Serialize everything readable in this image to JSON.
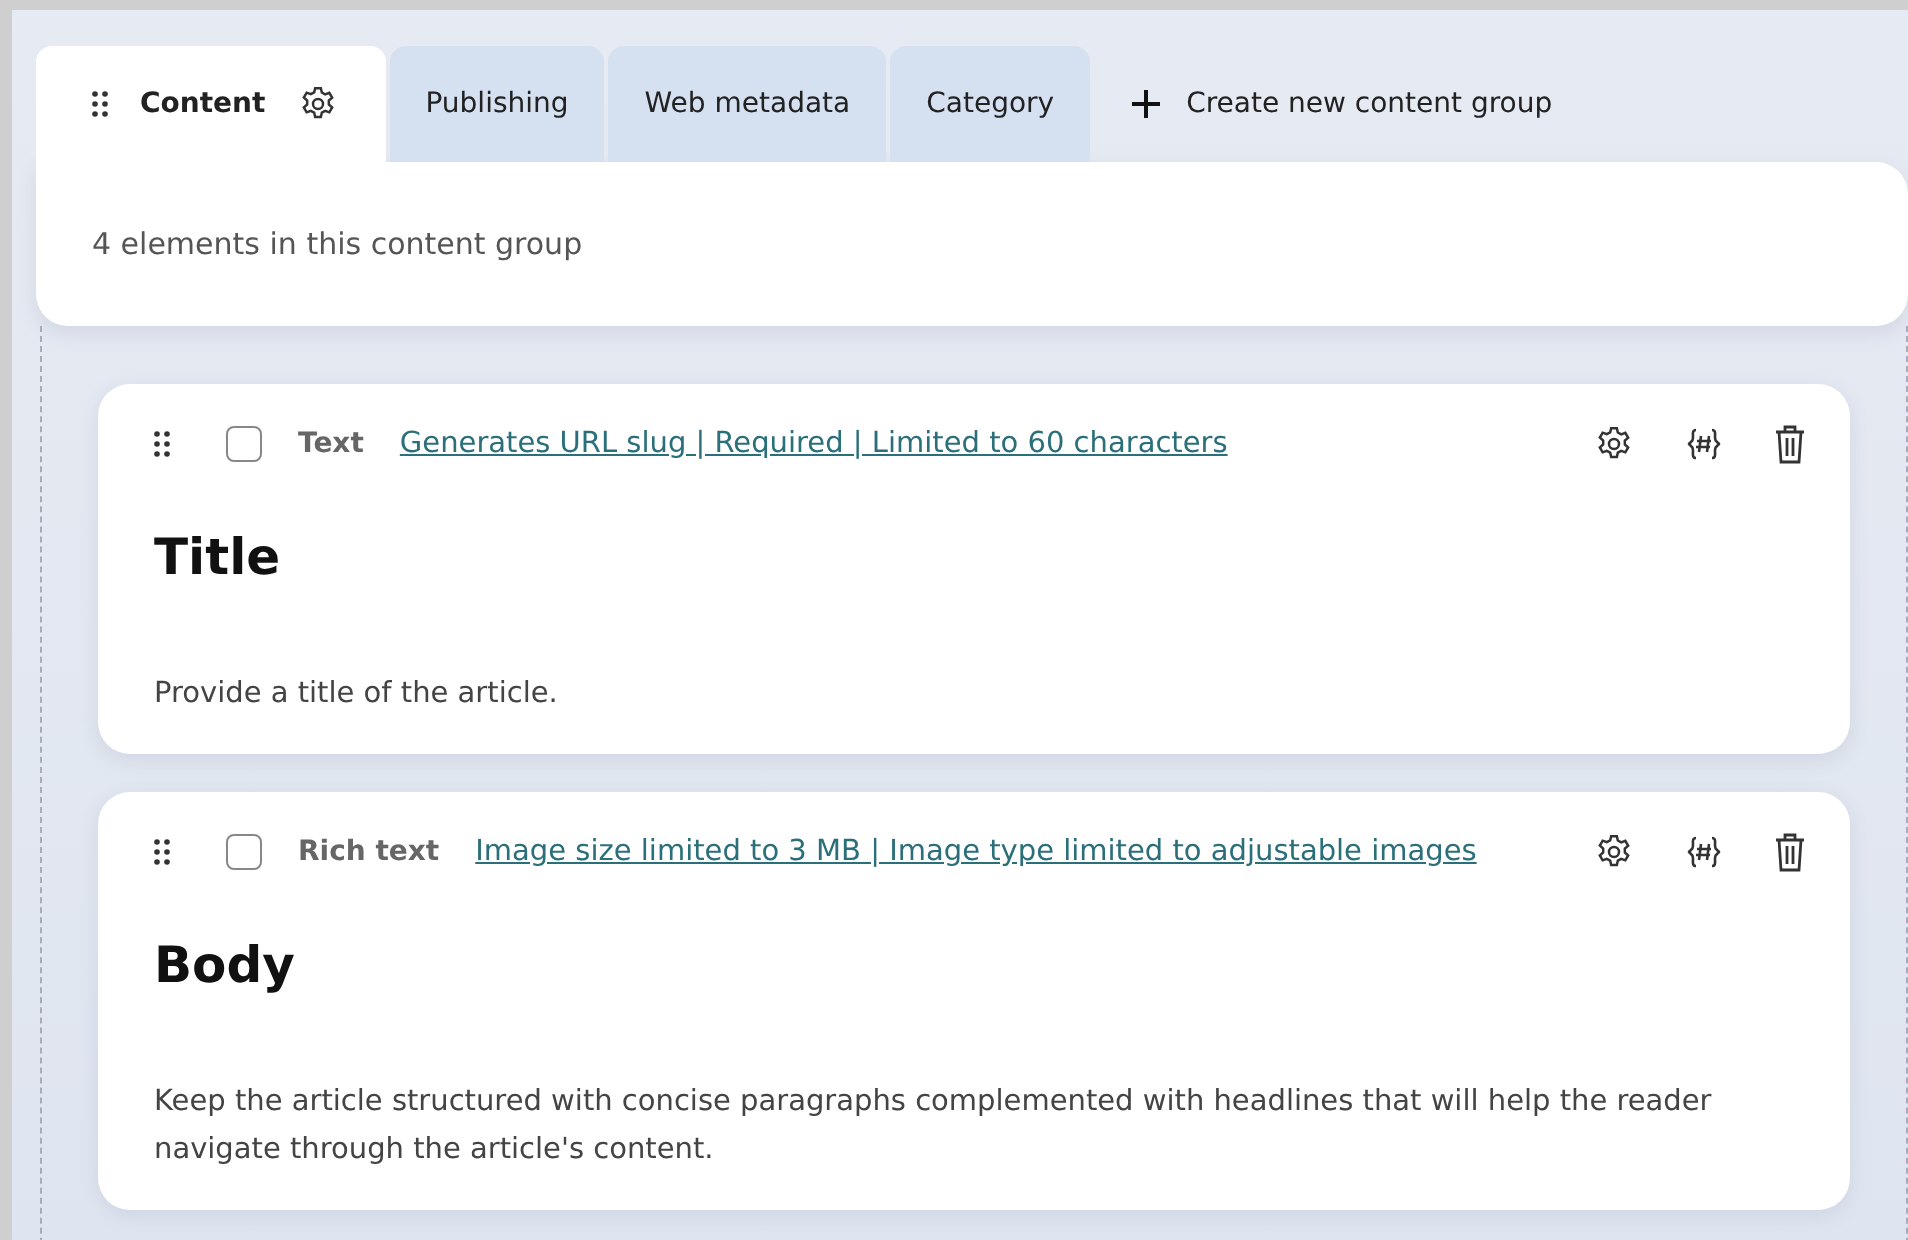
{
  "tabs": [
    {
      "label": "Content",
      "selected": true,
      "kind": "group"
    },
    {
      "label": "Publishing",
      "selected": false,
      "kind": "group"
    },
    {
      "label": "Web metadata",
      "selected": false,
      "kind": "group"
    },
    {
      "label": "Category",
      "selected": false,
      "kind": "group"
    },
    {
      "label": "Create new content group",
      "selected": false,
      "kind": "create"
    }
  ],
  "group_summary": "4 elements in this content group",
  "elements": [
    {
      "type": "Text",
      "guidelines_link": "Generates URL slug | Required | Limited to 60 characters",
      "name": "Title",
      "description": "Provide a title of the article.",
      "checked": false
    },
    {
      "type": "Rich text",
      "guidelines_link": "Image size limited to 3 MB | Image type limited to adjustable images",
      "name": "Body",
      "description": "Keep the article structured with concise paragraphs complemented with headlines that will help the reader navigate through the article's content.",
      "checked": false
    }
  ]
}
